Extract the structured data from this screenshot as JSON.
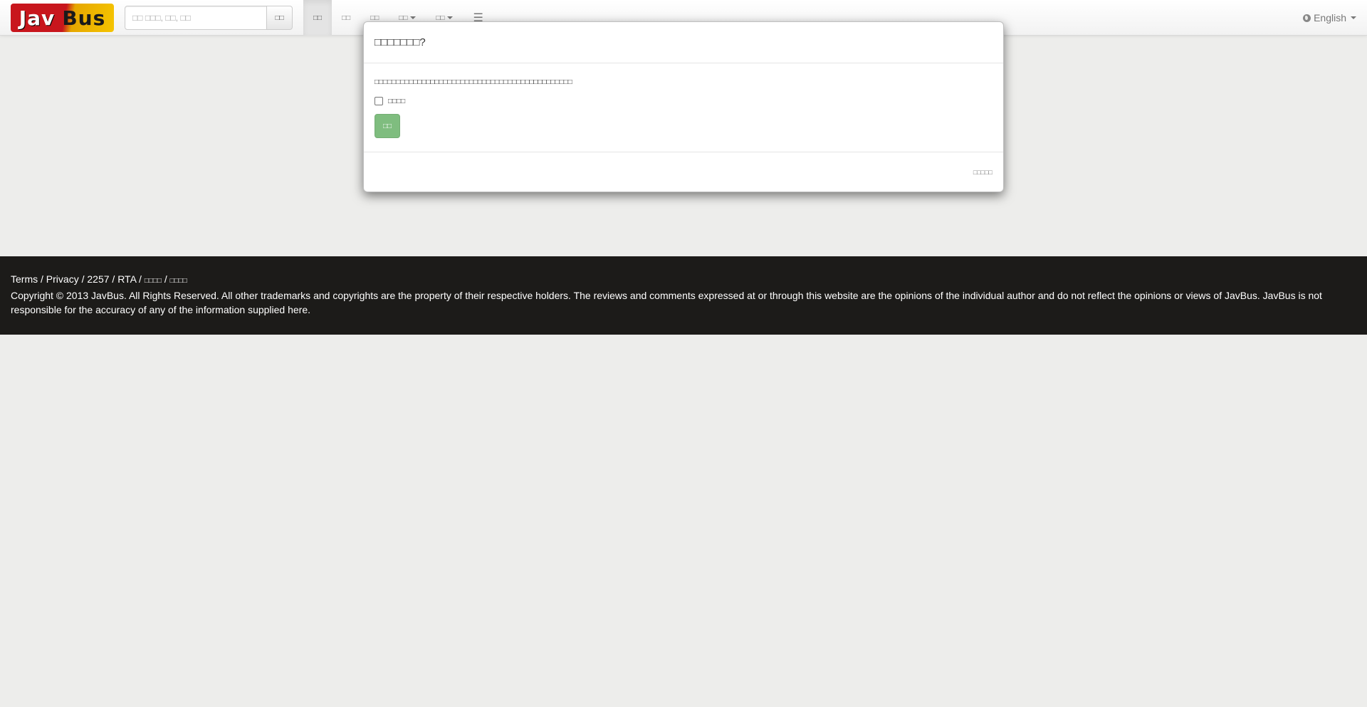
{
  "brand": {
    "logo_part1": "Jav",
    "logo_part2": "Bus"
  },
  "search": {
    "placeholder": "□□ □□□, □□, □□",
    "button_label": "□□"
  },
  "nav": {
    "items": [
      {
        "label": "□□"
      },
      {
        "label": "□□"
      },
      {
        "label": "□□"
      },
      {
        "label": "□□"
      },
      {
        "label": "□□"
      }
    ],
    "menu_icon": "☰"
  },
  "language": {
    "label": "English"
  },
  "modal": {
    "title": "□□□□□□□?",
    "text": "□□□□□□□□□□□□□□□□□□□□□□□□□□□□□□□□□□□□□□□□□□□□□□",
    "checkbox_label": "□□□□",
    "confirm_label": "□□",
    "footer_note": "□□□□□"
  },
  "footer": {
    "links": [
      "Terms",
      "Privacy",
      "2257",
      "RTA",
      "□□□□",
      "□□□□"
    ],
    "copyright": "Copyright © 2013 JavBus. All Rights Reserved. All other trademarks and copyrights are the property of their respective holders. The reviews and comments expressed at or through this website are the opinions of the individual author and do not reflect the opinions or views of JavBus. JavBus is not responsible for the accuracy of any of the information supplied here."
  }
}
